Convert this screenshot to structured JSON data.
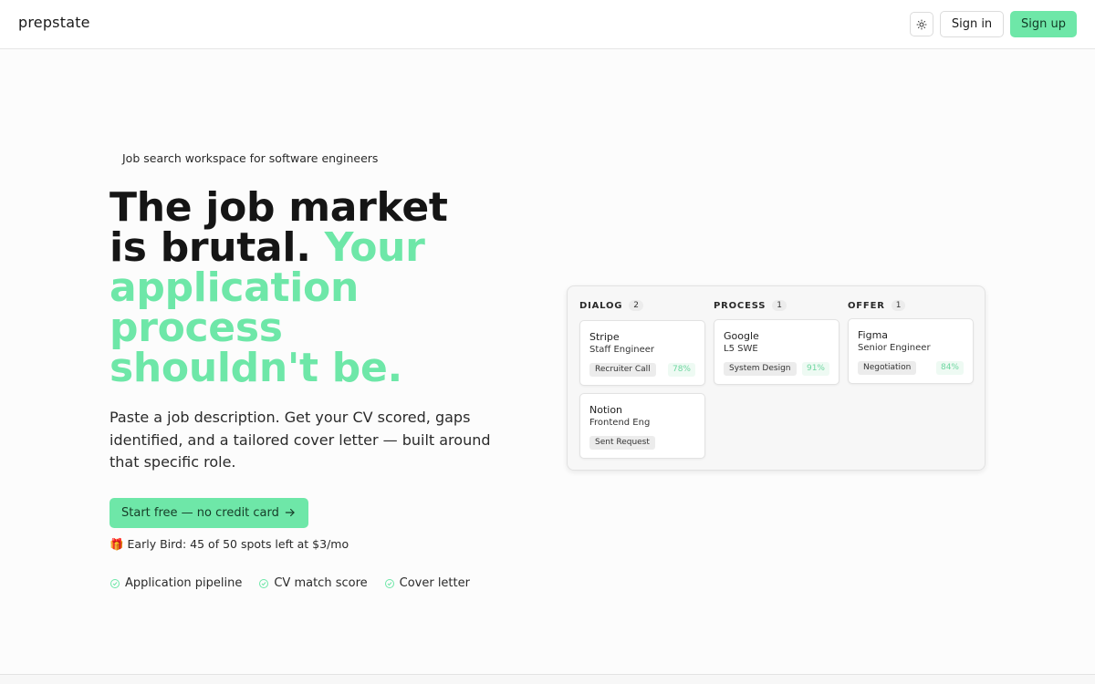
{
  "header": {
    "brand": "prepstate",
    "theme_icon": "sun-icon",
    "signin_label": "Sign in",
    "signup_label": "Sign up"
  },
  "hero": {
    "eyebrow": "Job search workspace for software engineers",
    "headline_lines": [
      "The job market",
      "is brutal."
    ],
    "headline_accent": "Your application process shouldn't be.",
    "headline_accent_word1": "Your",
    "headline_accent_rest": [
      "application",
      "process",
      "shouldn't be."
    ],
    "lead": "Paste a job description. Get your CV scored, gaps identified, and a tailored cover letter — built around that specific role.",
    "cta_label": "Start free — no credit card",
    "cta_icon": "arrow-right-icon",
    "earlybird": "🎁 Early Bird: 45 of 50 spots left at $3/mo",
    "features": [
      "Application pipeline",
      "CV match score",
      "Cover letter"
    ],
    "feature_icon": "check-circle-icon",
    "accent_color": "#6ee7a8"
  },
  "board": {
    "columns": [
      {
        "name": "DIALOG",
        "count": "2",
        "cards": [
          {
            "company": "Stripe",
            "role": "Staff Engineer",
            "stage": "Recruiter Call",
            "score": "78%"
          },
          {
            "company": "Notion",
            "role": "Frontend Eng",
            "stage": "Sent Request",
            "score": ""
          }
        ]
      },
      {
        "name": "PROCESS",
        "count": "1",
        "cards": [
          {
            "company": "Google",
            "role": "L5 SWE",
            "stage": "System Design",
            "score": "91%"
          }
        ]
      },
      {
        "name": "OFFER",
        "count": "1",
        "cards": [
          {
            "company": "Figma",
            "role": "Senior Engineer",
            "stage": "Negotiation",
            "score": "84%"
          }
        ]
      }
    ]
  }
}
